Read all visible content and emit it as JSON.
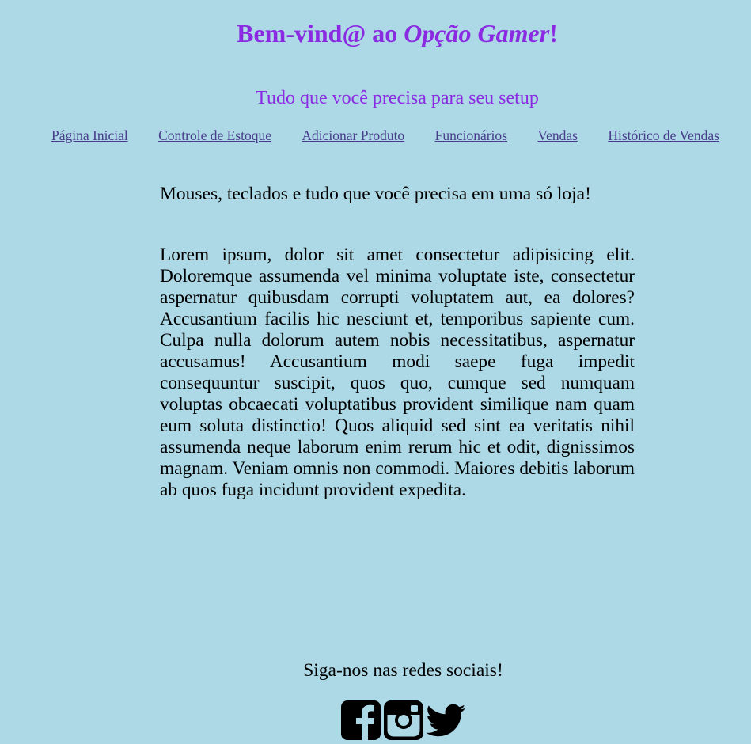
{
  "header": {
    "title_prefix": "Bem-vind@ ao ",
    "title_brand": "Opção Gamer",
    "title_suffix": "!",
    "subtitle": "Tudo que você precisa para seu setup"
  },
  "nav": {
    "items": [
      {
        "label": "Página Inicial"
      },
      {
        "label": "Controle de Estoque"
      },
      {
        "label": "Adicionar Produto"
      },
      {
        "label": "Funcionários"
      },
      {
        "label": "Vendas"
      },
      {
        "label": "Histórico de Vendas"
      }
    ]
  },
  "main": {
    "tagline": "Mouses, teclados e tudo que você precisa em uma só loja!",
    "body": "Lorem ipsum, dolor sit amet consectetur adipisicing elit. Doloremque assumenda vel minima voluptate iste, consectetur aspernatur quibusdam corrupti voluptatem aut, ea dolores? Accusantium facilis hic nesciunt et, temporibus sapiente cum. Culpa nulla dolorum autem nobis necessitatibus, aspernatur accusamus! Accusantium modi saepe fuga impedit consequuntur suscipit, quos quo, cumque sed numquam voluptas obcaecati voluptatibus provident similique nam quam eum soluta distinctio! Quos aliquid sed sint ea veritatis nihil assumenda neque laborum enim rerum hic et odit, dignissimos magnam. Veniam omnis non commodi. Maiores debitis laborum ab quos fuga incidunt provident expedita."
  },
  "footer": {
    "follow_text": "Siga-nos nas redes sociais!",
    "social_icons": [
      "facebook-icon",
      "instagram-icon",
      "twitter-icon"
    ]
  },
  "colors": {
    "background": "#add8e6",
    "accent": "#8a2be2",
    "link": "#483d8b"
  }
}
